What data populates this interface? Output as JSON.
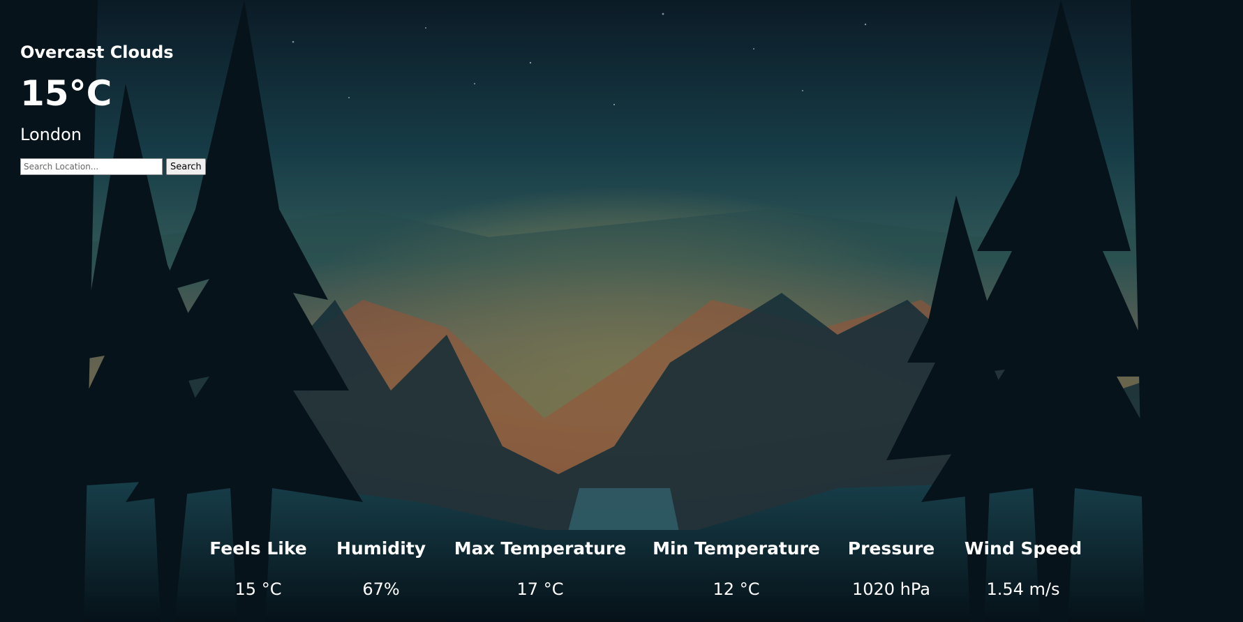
{
  "weather": {
    "condition": "Overcast Clouds",
    "temperature": "15°C",
    "city": "London"
  },
  "search": {
    "placeholder": "Search Location...",
    "value": "",
    "button_label": "Search"
  },
  "stats": [
    {
      "label": "Feels Like",
      "value": "15 °C"
    },
    {
      "label": "Humidity",
      "value": "67%"
    },
    {
      "label": "Max Temperature",
      "value": "17 °C"
    },
    {
      "label": "Min Temperature",
      "value": "12 °C"
    },
    {
      "label": "Pressure",
      "value": "1020 hPa"
    },
    {
      "label": "Wind Speed",
      "value": "1.54 m/s"
    }
  ],
  "colors": {
    "text": "#ffffff",
    "sky_top": "#0e2432",
    "sky_mid": "#1d4b55",
    "sunset": "#e9a14c",
    "forest_dark": "#0a1a24"
  },
  "background": {
    "icon": "forest-landscape-image"
  }
}
